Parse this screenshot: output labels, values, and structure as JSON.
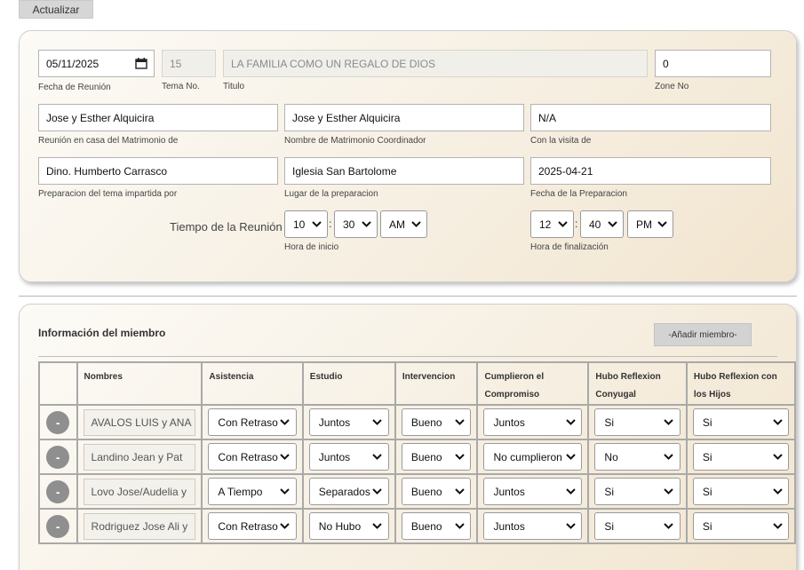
{
  "top_button": "Actualizar",
  "meeting": {
    "date": {
      "value": "05/11/2025",
      "label": "Fecha de Reunión"
    },
    "tema_no": {
      "value": "15",
      "label": "Tema No."
    },
    "titulo": {
      "value": "LA FAMILIA COMO UN REGALO DE DIOS",
      "label": "Titulo"
    },
    "zone_no": {
      "value": "0",
      "label": "Zone No"
    },
    "host": {
      "value": "Jose y Esther Alquicira",
      "label": "Reunión en casa del Matrimonio de"
    },
    "coordinator": {
      "value": "Jose y Esther Alquicira",
      "label": "Nombre de Matrimonio Coordinador"
    },
    "visit": {
      "value": "N/A",
      "label": "Con la visita de"
    },
    "prep_by": {
      "value": "Dino. Humberto Carrasco",
      "label": "Preparacion del tema impartida por"
    },
    "prep_place": {
      "value": "Iglesia  San Bartolome",
      "label": "Lugar de la preparacion"
    },
    "prep_date": {
      "value": "2025-04-21",
      "label": "Fecha de la Preparacion"
    },
    "time_label": "Tiempo de la Reunión",
    "start": {
      "hour": "10",
      "minute": "30",
      "ampm": "AM",
      "label": "Hora de inicio"
    },
    "end": {
      "hour": "12",
      "minute": "40",
      "ampm": "PM",
      "label": "Hora de finalización"
    }
  },
  "members_section": {
    "title": "Información del miembro",
    "add_button": "-Añadir miembro-",
    "columns": [
      "",
      "Nombres",
      "Asistencia",
      "Estudio",
      "Intervencion",
      "Cumplieron el Compromiso",
      "Hubo Reflexion Conyugal",
      "Hubo Reflexion con los Hijos"
    ],
    "remove_label": "-",
    "rows": [
      {
        "name": "AVALOS LUIS y ANA",
        "asistencia": "Con Retraso",
        "estudio": "Juntos",
        "intervencion": "Bueno",
        "compromiso": "Juntos",
        "conyugal": "Si",
        "hijos": "Si"
      },
      {
        "name": "Landino  Jean y Pat",
        "asistencia": "Con Retraso",
        "estudio": "Juntos",
        "intervencion": "Bueno",
        "compromiso": "No cumplieron",
        "conyugal": "No",
        "hijos": "Si"
      },
      {
        "name": "Lovo Jose/Audelia y",
        "asistencia": "A Tiempo",
        "estudio": "Separados",
        "intervencion": "Bueno",
        "compromiso": "Juntos",
        "conyugal": "Si",
        "hijos": "Si"
      },
      {
        "name": "Rodriguez Jose Ali y",
        "asistencia": "Con Retraso",
        "estudio": "No Hubo",
        "intervencion": "Bueno",
        "compromiso": "Juntos",
        "conyugal": "Si",
        "hijos": "Si"
      }
    ]
  }
}
